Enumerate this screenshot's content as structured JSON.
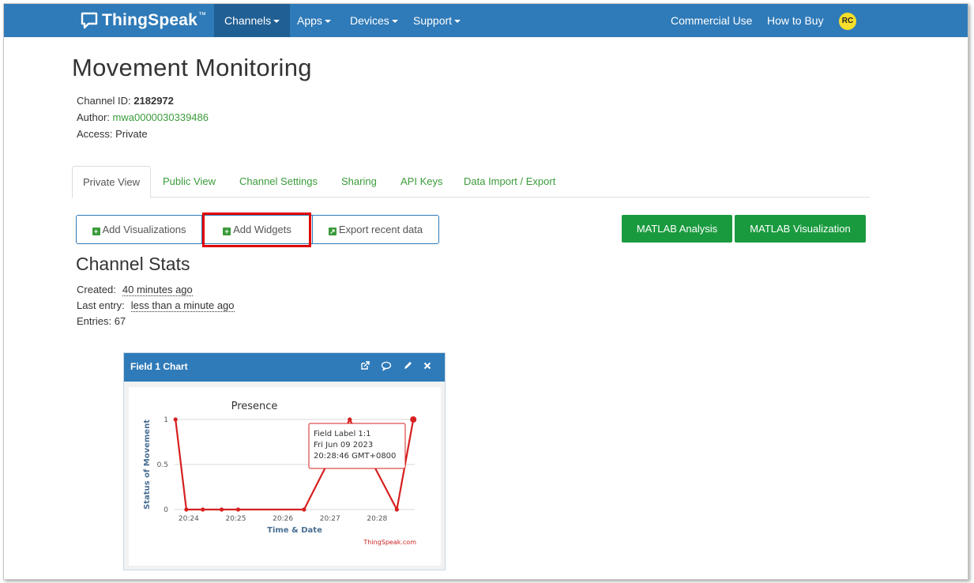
{
  "navbar": {
    "brand": "ThingSpeak",
    "brand_tm": "™",
    "items": [
      {
        "label": "Channels",
        "active": true,
        "dropdown": true
      },
      {
        "label": "Apps",
        "dropdown": true
      },
      {
        "label": "Devices",
        "dropdown": true
      },
      {
        "label": "Support",
        "dropdown": true
      }
    ],
    "right_items": [
      {
        "label": "Commercial Use"
      },
      {
        "label": "How to Buy"
      }
    ],
    "avatar": "RC",
    "colors": {
      "bar": "#2f7ab8",
      "active": "#1f5f94",
      "avatar": "#f6de2b"
    }
  },
  "channel": {
    "title": "Movement Monitoring",
    "id_label": "Channel ID:",
    "id_value": "2182972",
    "author_label": "Author:",
    "author_value": "mwa0000030339486",
    "access_label": "Access:",
    "access_value": "Private"
  },
  "tabs": [
    {
      "label": "Private View",
      "active": true
    },
    {
      "label": "Public View"
    },
    {
      "label": "Channel Settings"
    },
    {
      "label": "Sharing"
    },
    {
      "label": "API Keys"
    },
    {
      "label": "Data Import / Export"
    }
  ],
  "actions": {
    "add_visualizations": "Add Visualizations",
    "add_widgets": "Add Widgets",
    "export_recent": "Export recent data",
    "matlab_analysis": "MATLAB Analysis",
    "matlab_visualization": "MATLAB Visualization"
  },
  "stats": {
    "title": "Channel Stats",
    "created_label": "Created:",
    "created_value": "40 minutes ago",
    "last_entry_label": "Last entry:",
    "last_entry_value": "less than a minute ago",
    "entries_label": "Entries:",
    "entries_value": "67"
  },
  "widget": {
    "title": "Field 1 Chart",
    "icons": [
      "external-link-icon",
      "comment-icon",
      "pencil-icon",
      "close-icon"
    ]
  },
  "chart_data": {
    "type": "line",
    "title": "Presence",
    "xlabel": "Time & Date",
    "ylabel": "Status of Movement",
    "credit": "ThingSpeak.com",
    "y_ticks": [
      "0",
      "0.5",
      "1"
    ],
    "ylim": [
      0,
      1
    ],
    "x_ticks": [
      "20:24",
      "20:25",
      "20:26",
      "20:27",
      "20:28"
    ],
    "x_tick_minutes": [
      24,
      25,
      26,
      27,
      28
    ],
    "xlim_minutes": [
      23.7,
      28.8
    ],
    "grid": true,
    "color": "#d62020",
    "series": [
      {
        "x_minutes": [
          23.72,
          23.95,
          24.3,
          24.7,
          25.05,
          26.45,
          27.42,
          28.42,
          28.77
        ],
        "values": [
          1,
          0,
          0,
          0,
          0,
          0,
          1,
          0,
          1
        ]
      }
    ],
    "tooltip": {
      "line1": "Field Label 1:1",
      "line2": "Fri Jun 09 2023",
      "line3": "20:28:46 GMT+0800"
    }
  }
}
